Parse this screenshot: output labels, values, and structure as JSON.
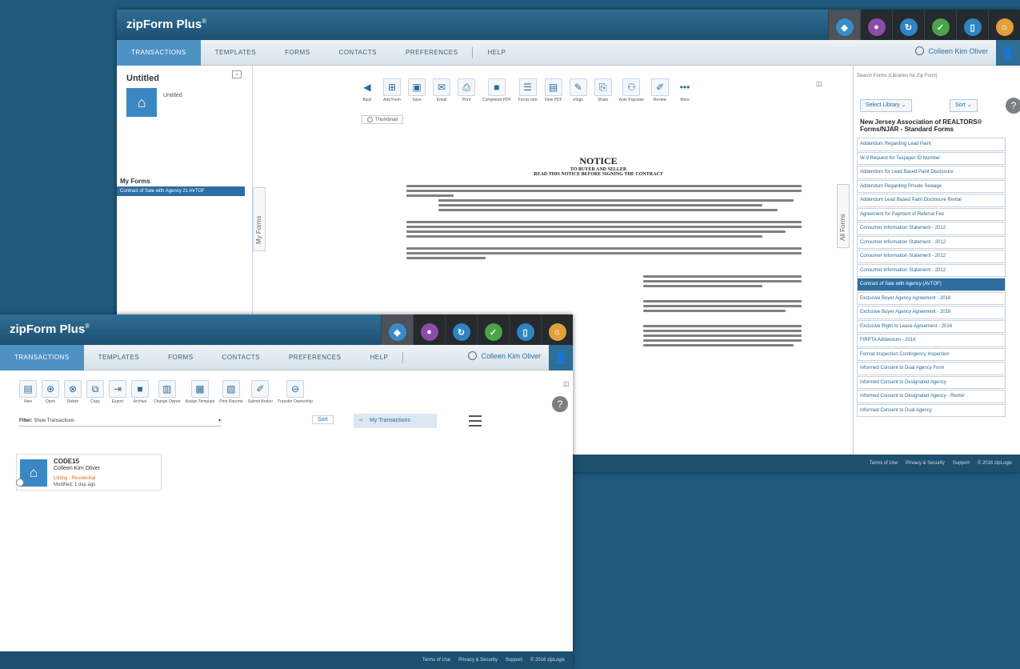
{
  "back": {
    "logo": "zipForm Plus",
    "nav": [
      "TRANSACTIONS",
      "TEMPLATES",
      "FORMS",
      "CONTACTS",
      "PREFERENCES",
      "HELP"
    ],
    "user": "Colleen Kim Oliver",
    "doc_title": "Untitled",
    "doc_sub": "Untitled",
    "my_forms": "My Forms",
    "my_forms_item": "Contract of Sale with Agency 21 AVTOF",
    "vtab_left": "My Forms",
    "vtab_right": "All Forms",
    "toolbar": [
      "Back",
      "Add Form",
      "Save",
      "Email",
      "Print",
      "Completed PDF",
      "Forms Info",
      "View PDF",
      "eSign",
      "Share",
      "Auto Populate",
      "Review",
      "More"
    ],
    "thumb_label": "Thumbnail",
    "notice_title": "NOTICE",
    "notice_sub1": "TO BUYER AND SELLER",
    "notice_sub2": "READ THIS NOTICE BEFORE SIGNING THE CONTRACT",
    "search_placeholder": "Search Forms (Libraries for Zip Form)",
    "select_library": "Select Library",
    "sort": "Sort",
    "library_head": "New Jersey Association of REALTORS® Forms/NJAR - Standard Forms",
    "library_items": [
      "Addendum Regarding Lead Paint",
      "W-9 Request for Taxpayer ID Number",
      "Addendum for Lead Based Paint Disclosure",
      "Addendum Regarding Private Sewage",
      "Addendum Lead Based Paint Disclosure Rental",
      "Agreement for Payment of Referral Fee",
      "Consumer Information Statement - 2012",
      "Consumer Information Statement - 2012",
      "Consumer Information Statement - 2012",
      "Consumer Information Statement - 2012",
      "Contract of Sale with Agency (AVTOF)",
      "Exclusive Buyer Agency Agreement - 2016",
      "Exclusive Buyer Agency Agreement - 2016",
      "Exclusive Right to Lease Agreement - 2016",
      "FIRPTA Addendum - 2016",
      "Formal Inspection Contingency Inspection",
      "Informed Consent to Dual Agency Form",
      "Informed Consent to Designated Agency",
      "Informed Consent to Designated Agency - Renter",
      "Informed Consent to Dual Agency"
    ],
    "footer": [
      "Terms of Use",
      "Privacy & Security",
      "Support",
      "© 2016 zipLogix"
    ]
  },
  "front": {
    "logo": "zipForm Plus",
    "nav": [
      "TRANSACTIONS",
      "TEMPLATES",
      "FORMS",
      "CONTACTS",
      "PREFERENCES",
      "HELP"
    ],
    "user": "Colleen Kim Oliver",
    "toolbar": [
      "New",
      "Open",
      "Delete",
      "Copy",
      "Export",
      "Archive",
      "Change Owner",
      "Assign Template",
      "Print Reports",
      "Submit Broker",
      "Transfer Ownership"
    ],
    "filter_label": "Filter:",
    "filter_value": "Show Transactions",
    "sort": "Sort",
    "share": "My Transactions",
    "card_title": "CODE15",
    "card_name": "Colleen Kim Oliver",
    "card_type": "Listing - Residential",
    "card_date": "Modified: 1 day ago",
    "footer": [
      "Terms of Use",
      "Privacy & Security",
      "Support",
      "© 2016 zipLogix"
    ]
  },
  "colors": {
    "background": "#1f5a7e",
    "accent": "#4e92c3"
  }
}
